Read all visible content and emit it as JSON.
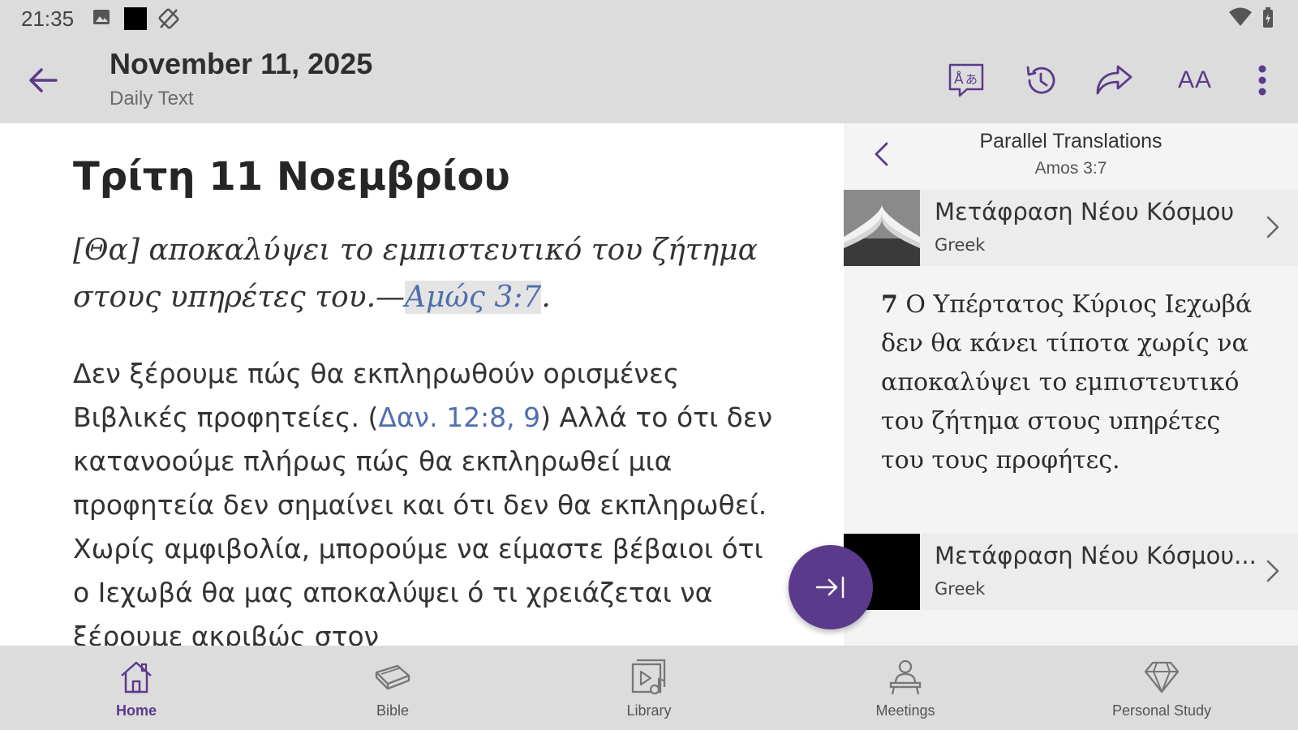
{
  "status_bar": {
    "time": "21:35",
    "icons": [
      "image-icon",
      "square-icon",
      "rotation-icon",
      "wifi-icon",
      "battery-icon"
    ]
  },
  "app_bar": {
    "title": "November 11, 2025",
    "subtitle": "Daily Text",
    "actions": [
      "translate-icon",
      "history-icon",
      "share-icon",
      "text-size-icon",
      "more-vert-icon"
    ],
    "text_size_label": "AA"
  },
  "article": {
    "heading": "Τρίτη 11 Νοεμβρίου",
    "theme_prefix": "[Θα] αποκαλύψει το εμπιστευτικό του ζήτημα στους υπηρέτες του.—",
    "theme_ref": "Αμώς 3:7",
    "theme_suffix": ".",
    "body_part1": "Δεν ξέρουμε πώς θα εκπληρωθούν ορισμένες Βιβλικές προφητείες. (",
    "body_ref": "Δαν. 12:8, 9",
    "body_part2": ") Αλλά το ότι δεν κατανοούμε πλήρως πώς θα εκπληρωθεί μια προφητεία δεν σημαίνει και ότι δεν θα εκπληρωθεί. Χωρίς αμφιβολία, μπορούμε να είμαστε βέβαιοι ότι ο Ιεχωβά θα μας αποκαλύψει ό τι χρειάζεται να ξέρουμε ακριβώς στον"
  },
  "side_panel": {
    "title": "Parallel Translations",
    "subtitle": "Amos 3:7",
    "translations": [
      {
        "name": "Μετάφραση Νέου Κόσμου",
        "language": "Greek"
      },
      {
        "name": "Μετάφραση Νέου Κόσμου...",
        "language": "Greek"
      }
    ],
    "verse_number": "7",
    "verse_text": " Ο Υπέρτατος Κύριος Ιεχωβά δεν θα κάνει τίποτα χωρίς να αποκαλύψει το εμπιστευτικό του ζήτημα στους υπηρέτες του τους προφήτες."
  },
  "bottom_nav": {
    "items": [
      {
        "label": "Home",
        "icon": "home-icon",
        "active": true
      },
      {
        "label": "Bible",
        "icon": "bible-icon",
        "active": false
      },
      {
        "label": "Library",
        "icon": "library-icon",
        "active": false
      },
      {
        "label": "Meetings",
        "icon": "meetings-icon",
        "active": false
      },
      {
        "label": "Personal Study",
        "icon": "personal-study-icon",
        "active": false
      }
    ]
  },
  "colors": {
    "accent": "#5b3a8c",
    "link": "#4f6fae",
    "bar_background": "#dcdcdc",
    "panel_background": "#f4f4f4"
  }
}
